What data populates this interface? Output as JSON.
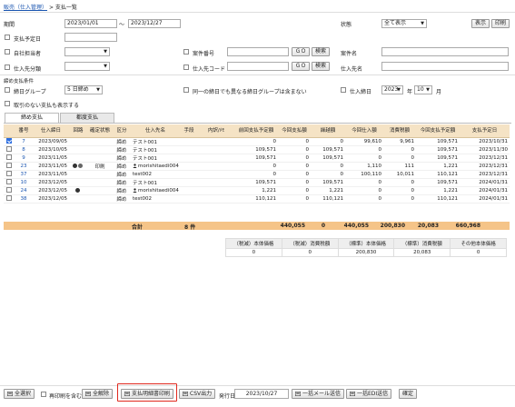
{
  "breadcrumb": {
    "link": "販売（仕入管理）",
    "sep": ">",
    "current": "支払一覧"
  },
  "filters": {
    "period_label": "期間",
    "date_from": "2023/01/01",
    "tilde": "〜",
    "date_to": "2023/12/27",
    "pay_due_label": "支払予定日",
    "own_staff_label": "自社担当者",
    "supplier_cat_label": "仕入先分類",
    "project_no_label": "案件番号",
    "supplier_code_label": "仕入先コード",
    "project_name_label": "案件名",
    "supplier_name_label": "仕入先名",
    "status_label": "状態",
    "status_value": "全て表示",
    "go_label": "ＧＯ",
    "search_label": "検索",
    "show_button": "表示",
    "print_button": "印刷"
  },
  "closing": {
    "heading": "締め支払条件",
    "group_label": "締日グループ",
    "group_value": "5 日締め",
    "same_day_label": "同一の締日でも異なる締日グループは含まない",
    "closing_day_label": "仕入締日",
    "year_value": "2023",
    "year_unit": "年",
    "month_value": "10",
    "month_unit": "月",
    "no_trade_label": "取引のない支払も表示する"
  },
  "tabs": [
    {
      "label": "締め支払"
    },
    {
      "label": "都度支払"
    }
  ],
  "table": {
    "headers": [
      "",
      "番号",
      "仕入締日",
      "回路",
      "確定状態",
      "区分",
      "仕入先名",
      "手段",
      "内訳/ﾒﾓ",
      "前回支払予定額",
      "今回支払額",
      "繰越額",
      "今回仕入額",
      "消費税額",
      "今回支払予定額",
      "支払予定日"
    ],
    "rows": [
      {
        "checked": true,
        "no": "7",
        "date": "2023/09/05",
        "icons": "",
        "status": "",
        "kubun": "締め",
        "name": "テスト001",
        "person": false,
        "method": "",
        "memo": "",
        "prev": "0",
        "paid": "0",
        "carry": "0",
        "purchase": "99,610",
        "tax": "9,961",
        "due": "109,571",
        "due_date": "2023/10/31"
      },
      {
        "checked": false,
        "no": "8",
        "date": "2023/10/05",
        "icons": "",
        "status": "",
        "kubun": "締め",
        "name": "テスト001",
        "person": false,
        "method": "",
        "memo": "",
        "prev": "109,571",
        "paid": "0",
        "carry": "109,571",
        "purchase": "0",
        "tax": "0",
        "due": "109,571",
        "due_date": "2023/11/30"
      },
      {
        "checked": false,
        "no": "9",
        "date": "2023/11/05",
        "icons": "",
        "status": "",
        "kubun": "締め",
        "name": "テスト001",
        "person": false,
        "method": "",
        "memo": "",
        "prev": "109,571",
        "paid": "0",
        "carry": "109,571",
        "purchase": "0",
        "tax": "0",
        "due": "109,571",
        "due_date": "2023/12/31"
      },
      {
        "checked": false,
        "no": "23",
        "date": "2023/11/05",
        "icons": "dd",
        "status": "印刷",
        "kubun": "締め",
        "name": "morishitaedi004",
        "person": true,
        "method": "",
        "memo": "",
        "prev": "0",
        "paid": "0",
        "carry": "0",
        "purchase": "1,110",
        "tax": "111",
        "due": "1,221",
        "due_date": "2023/12/31"
      },
      {
        "checked": false,
        "no": "37",
        "date": "2023/11/05",
        "icons": "",
        "status": "",
        "kubun": "締め",
        "name": "test002",
        "person": false,
        "method": "",
        "memo": "",
        "prev": "0",
        "paid": "0",
        "carry": "0",
        "purchase": "100,110",
        "tax": "10,011",
        "due": "110,121",
        "due_date": "2023/12/31"
      },
      {
        "checked": false,
        "no": "10",
        "date": "2023/12/05",
        "icons": "",
        "status": "",
        "kubun": "締め",
        "name": "テスト001",
        "person": false,
        "method": "",
        "memo": "",
        "prev": "109,571",
        "paid": "0",
        "carry": "109,571",
        "purchase": "0",
        "tax": "0",
        "due": "109,571",
        "due_date": "2024/01/31"
      },
      {
        "checked": false,
        "no": "24",
        "date": "2023/12/05",
        "icons": "d",
        "status": "",
        "kubun": "締め",
        "name": "morishitaedi004",
        "person": true,
        "method": "",
        "memo": "",
        "prev": "1,221",
        "paid": "0",
        "carry": "1,221",
        "purchase": "0",
        "tax": "0",
        "due": "1,221",
        "due_date": "2024/01/31"
      },
      {
        "checked": false,
        "no": "38",
        "date": "2023/12/05",
        "icons": "",
        "status": "",
        "kubun": "締め",
        "name": "test002",
        "person": false,
        "method": "",
        "memo": "",
        "prev": "110,121",
        "paid": "0",
        "carry": "110,121",
        "purchase": "0",
        "tax": "0",
        "due": "110,121",
        "due_date": "2024/01/31"
      }
    ]
  },
  "totals": {
    "label": "合計",
    "count": "8 件",
    "prev": "440,055",
    "paid": "0",
    "carry": "440,055",
    "purchase": "200,830",
    "tax": "20,083",
    "due": "660,968"
  },
  "summary": {
    "headers": [
      "（税減）本体価格",
      "（税減）消費税額",
      "（標準）本体価格",
      "（標準）消費税額",
      "その他本体価格"
    ],
    "values": [
      "0",
      "0",
      "200,830",
      "20,083",
      "0"
    ]
  },
  "footer": {
    "select_all": "全選択",
    "include_paid": "再印刷を含む",
    "deselect_all": "全解除",
    "print_statement": "支払明細書印刷",
    "csv": "CSV出力",
    "issue_date_label": "発行日",
    "issue_date": "2023/10/27",
    "mail_send": "一括メール送信",
    "edi_send": "一括EDI送信",
    "confirm": "確定"
  }
}
